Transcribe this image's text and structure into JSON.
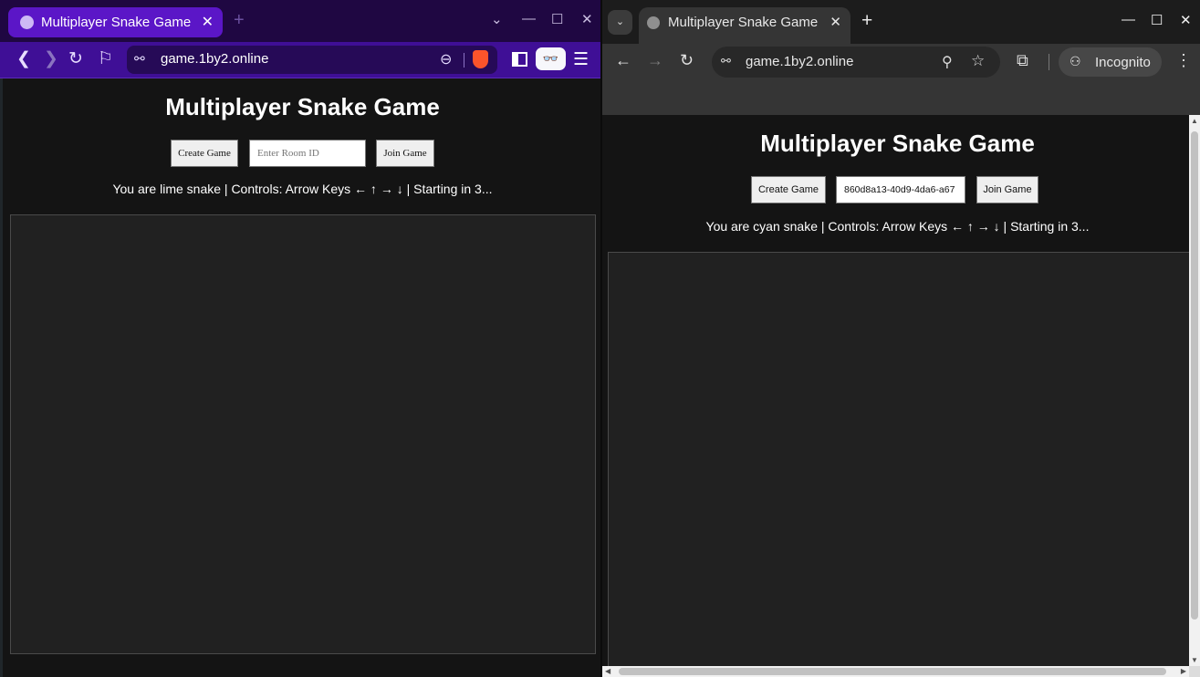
{
  "left_window": {
    "browser": "Brave",
    "tab": {
      "title": "Multiplayer Snake Game",
      "close": "✕"
    },
    "new_tab": "+",
    "window_controls": {
      "tab_list": "⌄",
      "minimize": "—",
      "maximize": "☐",
      "close": "✕"
    },
    "toolbar": {
      "back": "❮",
      "forward": "❯",
      "reload": "↻",
      "bookmark": "⚐",
      "site_info": "⚯",
      "url": "game.1by2.online",
      "zoom": "⊖",
      "shields": "👓",
      "menu": "☰"
    },
    "page": {
      "heading": "Multiplayer Snake Game",
      "create_button": "Create Game",
      "room_input_value": "",
      "room_input_placeholder": "Enter Room ID",
      "join_button": "Join Game",
      "status": "You are lime snake | Controls: Arrow Keys ← ↑ → ↓ | Starting in 3..."
    }
  },
  "right_window": {
    "browser": "Chrome",
    "tab_search": "⌄",
    "tab": {
      "title": "Multiplayer Snake Game",
      "close": "✕"
    },
    "new_tab": "+",
    "window_controls": {
      "minimize": "—",
      "maximize": "☐",
      "close": "✕"
    },
    "toolbar": {
      "back": "←",
      "forward": "→",
      "reload": "↻",
      "site_info": "⚯",
      "url": "game.1by2.online",
      "zoom": "⚲",
      "star": "☆",
      "extensions": "⧉",
      "incognito_label": "Incognito",
      "incognito_icon": "⚇",
      "menu": "⋮"
    },
    "page": {
      "heading": "Multiplayer Snake Game",
      "create_button": "Create Game",
      "room_input_value": "860d8a13-40d9-4da6-a67",
      "room_input_placeholder": "Enter Room ID",
      "join_button": "Join Game",
      "status": "You are cyan snake | Controls: Arrow Keys ← ↑ → ↓ | Starting in 3..."
    },
    "scrollbar_arrows": {
      "up": "▲",
      "down": "▼",
      "left": "◀",
      "right": "▶"
    }
  },
  "colors": {
    "brave_tab_active": "#5b16c7",
    "brave_toolbar": "#3f0f96",
    "chrome_toolbar": "#353535",
    "page_background": "#141414",
    "board_background": "#212121"
  }
}
